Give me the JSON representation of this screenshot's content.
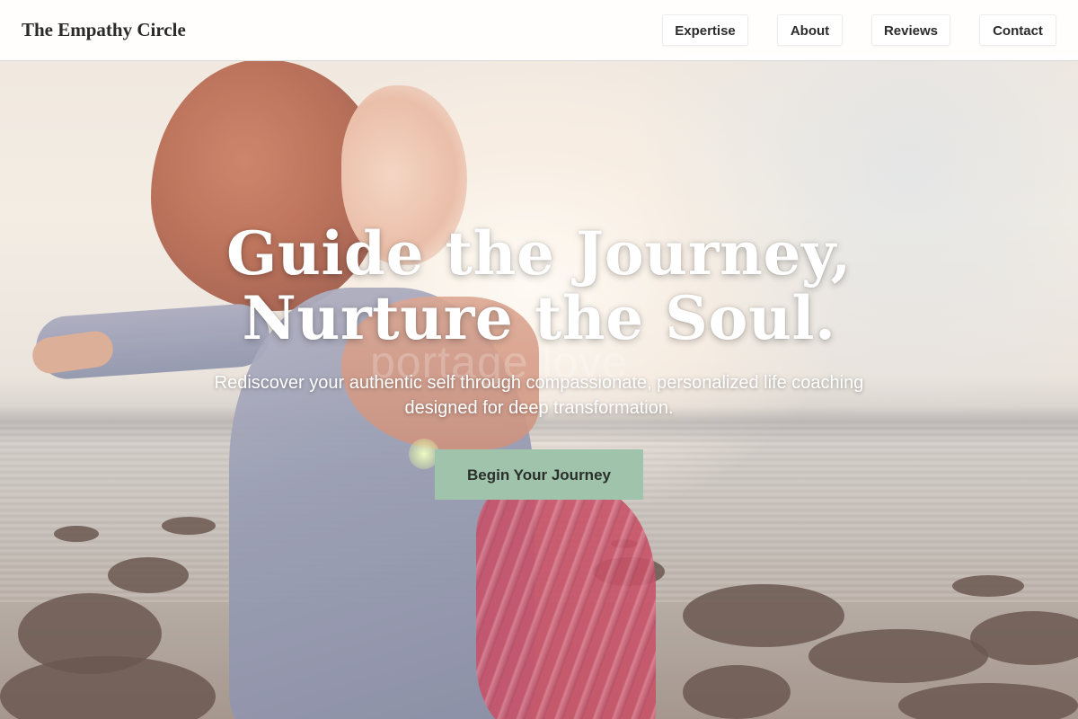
{
  "header": {
    "logo": "The Empathy Circle",
    "nav": [
      {
        "label": "Expertise"
      },
      {
        "label": "About"
      },
      {
        "label": "Reviews"
      },
      {
        "label": "Contact"
      }
    ]
  },
  "hero": {
    "title_line1": "Guide the Journey,",
    "title_line2": "Nurture the Soul.",
    "subtitle_line1": "Rediscover your authentic self through compassionate, personalized life coaching",
    "subtitle_line2": "designed for deep transformation.",
    "cta_label": "Begin Your Journey",
    "background_watermark": "portage love"
  },
  "colors": {
    "cta_background": "#9fc4ab",
    "header_background": "#ffffff",
    "title_text": "#ffffff"
  }
}
